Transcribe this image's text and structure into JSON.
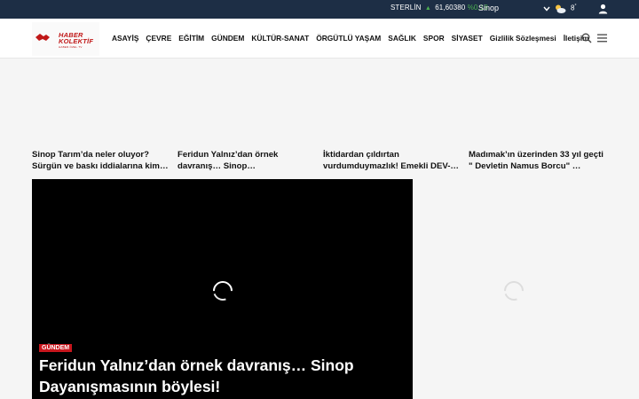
{
  "topbar": {
    "currency_name": "STERLİN",
    "currency_value": "61,60380",
    "currency_change": "%0,18",
    "city": "Sinop",
    "temperature": "8",
    "temperature_unit": "°"
  },
  "header": {
    "logo_line1": "HABER",
    "logo_line2": "KOLEKTİF",
    "logo_tagline": "HABER·ÖZEL·TV",
    "nav": [
      "ASAYİŞ",
      "ÇEVRE",
      "EĞİTİM",
      "GÜNDEM",
      "KÜLTÜR-SANAT",
      "ÖRGÜTLÜ YAŞAM",
      "SAĞLIK",
      "SPOR",
      "SİYASET",
      "Gizlilik Sözleşmesi",
      "İletişim"
    ]
  },
  "headlines": [
    "Sinop Tarım’da neler oluyor? Sürgün ve baskı iddialarına kim…",
    "Feridun Yalnız’dan örnek davranış… Sinop Dayanışmasını…",
    "İktidardan çıldırtan vurdumduymazlık! Emekli DEV-…",
    "Madımak’ın üzerinden 33 yıl geçti \" Devletin Namus Borcu\" …"
  ],
  "hero": {
    "category": "GÜNDEM",
    "title": "Feridun Yalnız’dan örnek davranış… Sinop Dayanışmasının böylesi!"
  },
  "colors": {
    "topbar_bg": "#1d2e45",
    "brand_red": "#c8161d",
    "up_green": "#4caf50"
  }
}
